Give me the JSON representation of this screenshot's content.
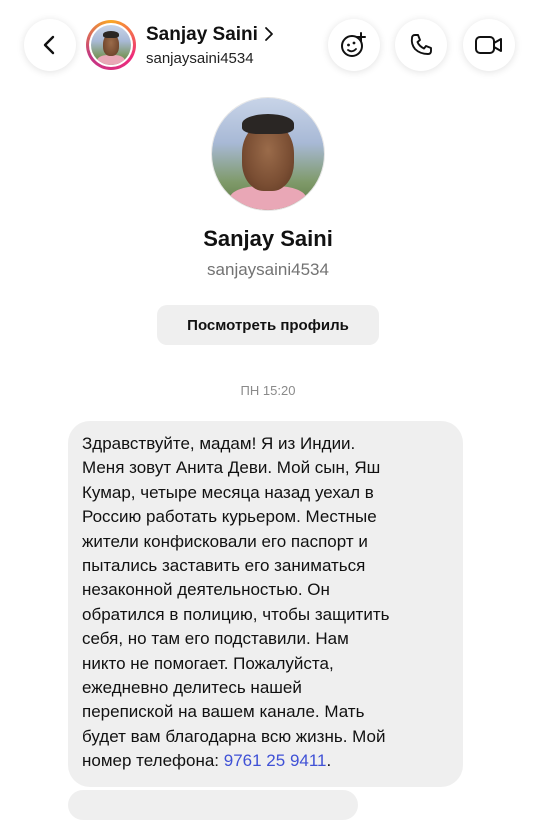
{
  "header": {
    "name": "Sanjay Saini",
    "username": "sanjaysaini4534"
  },
  "profile": {
    "name": "Sanjay Saini",
    "username": "sanjaysaini4534",
    "view_profile_label": "Посмотреть профиль"
  },
  "chat": {
    "timestamp": "ПН 15:20",
    "message_text": "Здравствуйте, мадам! Я из Индии.\nМеня зовут Анита Деви. Мой сын, Яш\nКумар, четыре месяца назад уехал в\nРоссию работать курьером. Местные\nжители конфисковали его паспорт и\nпытались заставить его заниматься\nнезаконной деятельностью. Он\nобратился в полицию, чтобы защитить\nсебя, но там его подставили. Нам\nникто не помогает. Пожалуйста,\nежедневно делитесь нашей\nперепиской на вашем канале. Мать\nбудет вам благодарна всю жизнь. Мой\nномер телефона: ",
    "phone_number": "9761 25 9411",
    "phone_suffix": "."
  },
  "icons": {
    "back": "chevron-left-icon",
    "effects": "face-sparkle-icon",
    "call": "phone-icon",
    "video": "video-camera-icon",
    "name_chevron": "chevron-right-icon"
  },
  "colors": {
    "link": "#3f51d6",
    "bubble": "#efefef",
    "muted_text": "#737373"
  }
}
